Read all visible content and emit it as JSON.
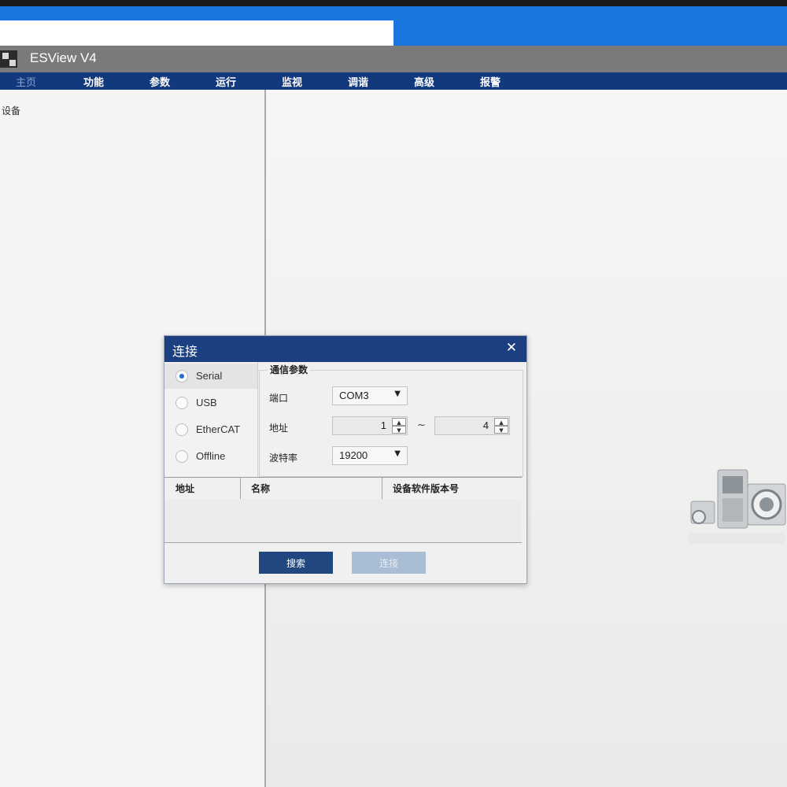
{
  "app": {
    "title": "ESView V4"
  },
  "menu": {
    "home": "主页",
    "items": [
      "功能",
      "参数",
      "运行",
      "监视",
      "调谐",
      "高级",
      "报警"
    ]
  },
  "sidebar": {
    "label": "设备"
  },
  "dialog": {
    "title": "连接",
    "close_icon": "close-icon",
    "connections": [
      {
        "label": "Serial",
        "selected": true
      },
      {
        "label": "USB",
        "selected": false
      },
      {
        "label": "EtherCAT",
        "selected": false
      },
      {
        "label": "Offline",
        "selected": false
      }
    ],
    "params": {
      "group_title": "通信参数",
      "port_label": "端口",
      "port_value": "COM3",
      "address_label": "地址",
      "address_from": "1",
      "address_to": "4",
      "range_separator": "~",
      "baud_label": "波特率",
      "baud_value": "19200"
    },
    "table": {
      "columns": [
        "地址",
        "名称",
        "设备软件版本号"
      ],
      "rows": []
    },
    "buttons": {
      "search": "搜索",
      "connect": "连接"
    }
  },
  "colors": {
    "taskbar": "#1976e0",
    "titlebar": "#7a7a7a",
    "menubar": "#12397e",
    "dialog_title": "#1b3f80",
    "primary_button": "#20477f",
    "disabled_button": "#a9bdd4"
  }
}
